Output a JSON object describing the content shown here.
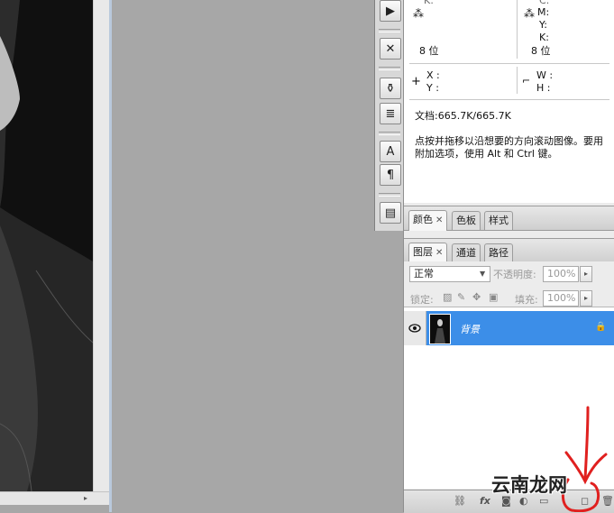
{
  "info": {
    "row1_right_top": "C:",
    "row1_k_left": "K:",
    "labels_cmyk": [
      "M:",
      "Y:",
      "K:"
    ],
    "bits_left": "8 位",
    "bits_right": "8 位",
    "x_label": "X :",
    "y_label": "Y :",
    "w_label": "W :",
    "h_label": "H :",
    "doc_size": "文档:665.7K/665.7K",
    "hint": "点按并拖移以沿想要的方向滚动图像。要用\n附加选项，使用 Alt 和 Ctrl 键。"
  },
  "color_panel": {
    "tabs": [
      {
        "label": "颜色"
      },
      {
        "label": "色板"
      },
      {
        "label": "样式"
      }
    ]
  },
  "layers_panel": {
    "tabs": [
      {
        "label": "图层"
      },
      {
        "label": "通道"
      },
      {
        "label": "路径"
      }
    ],
    "blend_mode": "正常",
    "opacity_label": "不透明度:",
    "opacity_value": "100%",
    "lock_label": "锁定:",
    "fill_label": "填充:",
    "fill_value": "100%",
    "layers": [
      {
        "name": "背景",
        "selected": true
      }
    ]
  },
  "watermark": "云南龙网",
  "colors": {
    "selected_layer": "#3c8ee8",
    "annotation_red": "#e0201f",
    "canvas_gray": "#a7a7a7"
  }
}
